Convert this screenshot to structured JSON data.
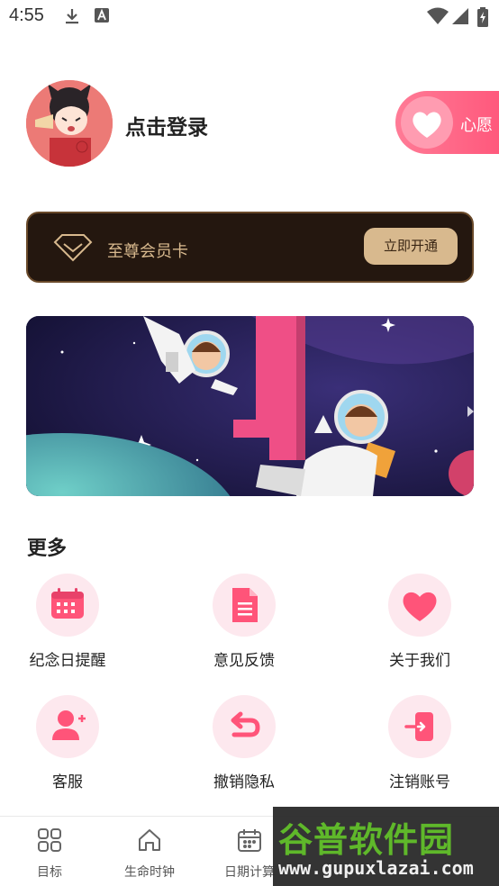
{
  "status_bar": {
    "time": "4:55",
    "icons": [
      "download-icon",
      "a-letter-icon",
      "wifi-icon",
      "signal-icon",
      "battery-charging-icon"
    ]
  },
  "profile": {
    "login_text": "点击登录",
    "wish_label": "心愿",
    "avatar_icon": "cartoon-girl-avatar"
  },
  "vip_card": {
    "title": "至尊会员卡",
    "button_label": "立即开通",
    "icon": "diamond-icon",
    "colors": {
      "background": "#24170f",
      "gold": "#d8b98e"
    }
  },
  "banner": {
    "illustration": "astronauts-space-banner"
  },
  "more": {
    "title": "更多",
    "items": [
      {
        "label": "纪念日提醒",
        "icon": "calendar-icon"
      },
      {
        "label": "意见反馈",
        "icon": "document-icon"
      },
      {
        "label": "关于我们",
        "icon": "heart-icon"
      },
      {
        "label": "客服",
        "icon": "add-user-icon"
      },
      {
        "label": "撤销隐私",
        "icon": "undo-icon"
      },
      {
        "label": "注销账号",
        "icon": "logout-icon"
      }
    ]
  },
  "bottom_nav": {
    "items": [
      {
        "label": "目标",
        "icon": "grid-icon"
      },
      {
        "label": "生命时钟",
        "icon": "home-icon"
      },
      {
        "label": "日期计算",
        "icon": "calendar-icon"
      }
    ]
  },
  "watermark": {
    "title": "谷普软件园",
    "url": "www.gupuxlazai.com"
  },
  "colors": {
    "accent_pink": "#ff5479",
    "icon_bg_pink": "#fde8ee"
  }
}
